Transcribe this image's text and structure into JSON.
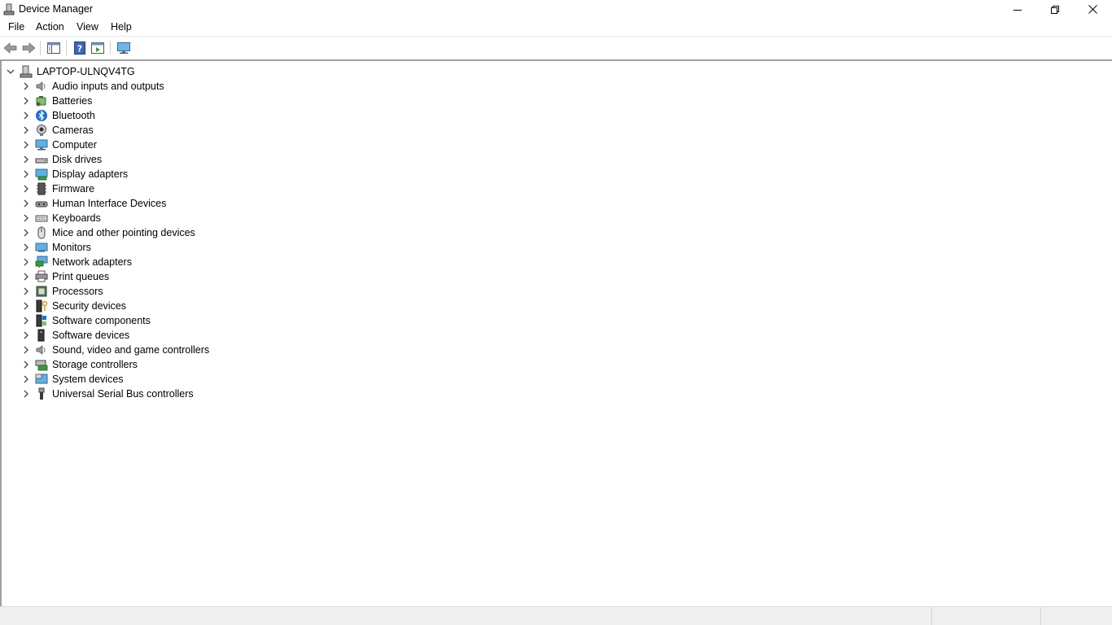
{
  "window": {
    "title": "Device Manager"
  },
  "menu": [
    "File",
    "Action",
    "View",
    "Help"
  ],
  "toolbar": {
    "buttons": [
      "back-arrow-icon",
      "forward-arrow-icon",
      "show-hide-console-tree-icon",
      "help-icon",
      "properties-icon",
      "monitor-icon"
    ]
  },
  "tree": {
    "root": "LAPTOP-ULNQV4TG",
    "categories": [
      "Audio inputs and outputs",
      "Batteries",
      "Bluetooth",
      "Cameras",
      "Computer",
      "Disk drives",
      "Display adapters",
      "Firmware",
      "Human Interface Devices",
      "Keyboards",
      "Mice and other pointing devices",
      "Monitors",
      "Network adapters",
      "Print queues",
      "Processors",
      "Security devices",
      "Software components",
      "Software devices",
      "Sound, video and game controllers",
      "Storage controllers",
      "System devices",
      "Universal Serial Bus controllers"
    ]
  },
  "colors": {
    "accent": "#1a6fd6",
    "tree_border": "#a0a0a0",
    "statusbar": "#f0f0f0"
  }
}
